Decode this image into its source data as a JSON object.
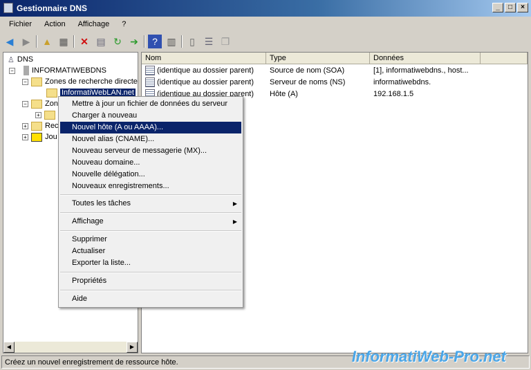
{
  "window": {
    "title": "Gestionnaire DNS"
  },
  "menu": [
    "Fichier",
    "Action",
    "Affichage",
    "?"
  ],
  "tree": {
    "root": "DNS",
    "server": "INFORMATIWEBDNS",
    "forward_zones": "Zones de recherche directe",
    "zone": "InformatiWebLAN.net",
    "reverse_zones": "Zon",
    "trust": "Rec",
    "logs": "Jou"
  },
  "list": {
    "columns": [
      "Nom",
      "Type",
      "Données"
    ],
    "rows": [
      {
        "name": "(identique au dossier parent)",
        "type": "Source de nom (SOA)",
        "data": "[1], informatiwebdns., host..."
      },
      {
        "name": "(identique au dossier parent)",
        "type": "Serveur de noms (NS)",
        "data": "informatiwebdns."
      },
      {
        "name": "(identique au dossier parent)",
        "type": "Hôte (A)",
        "data": "192.168.1.5"
      }
    ]
  },
  "context_menu": {
    "items": [
      "Mettre à jour un fichier de données du serveur",
      "Charger à nouveau",
      "Nouvel hôte (A ou AAAA)...",
      "Nouvel alias (CNAME)...",
      "Nouveau serveur de messagerie (MX)...",
      "Nouveau domaine...",
      "Nouvelle délégation...",
      "Nouveaux enregistrements...",
      "Toutes les tâches",
      "Affichage",
      "Supprimer",
      "Actualiser",
      "Exporter la liste...",
      "Propriétés",
      "Aide"
    ],
    "highlighted": "Nouvel hôte (A ou AAAA)..."
  },
  "status": "Créez un nouvel enregistrement de ressource hôte.",
  "watermark": "InformatiWeb-Pro.net"
}
